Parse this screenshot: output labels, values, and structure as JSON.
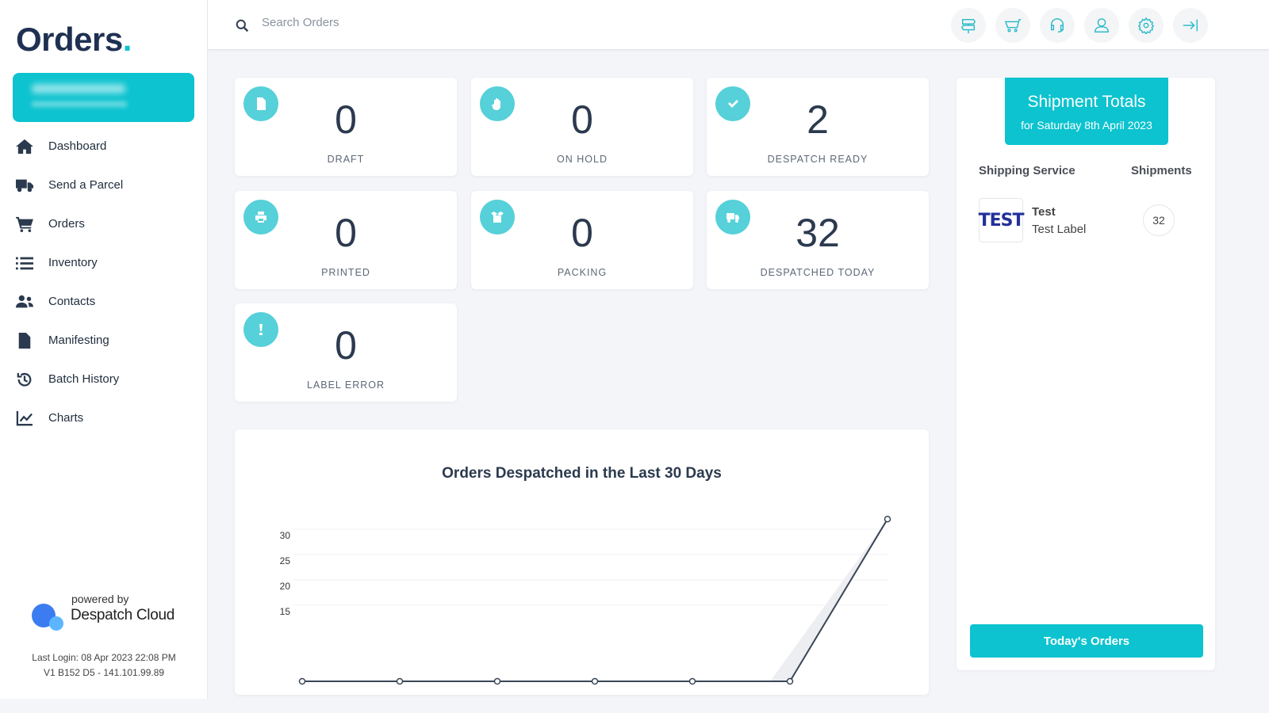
{
  "sidebar": {
    "logo": "Orders",
    "logo_dot": ".",
    "nav": [
      {
        "label": "Dashboard",
        "icon": "home-icon"
      },
      {
        "label": "Send a Parcel",
        "icon": "truck-icon"
      },
      {
        "label": "Orders",
        "icon": "cart-icon"
      },
      {
        "label": "Inventory",
        "icon": "list-icon"
      },
      {
        "label": "Contacts",
        "icon": "users-icon"
      },
      {
        "label": "Manifesting",
        "icon": "document-icon"
      },
      {
        "label": "Batch History",
        "icon": "history-icon"
      },
      {
        "label": "Charts",
        "icon": "line-chart-icon"
      }
    ],
    "powered_by": "powered by",
    "brand": "Despatch Cloud",
    "last_login": "Last Login: 08 Apr 2023 22:08 PM",
    "version": "V1 B152 D5 - 141.101.99.89"
  },
  "topbar": {
    "search_placeholder": "Search Orders",
    "icons": [
      "signpost-icon",
      "cart-icon",
      "headset-icon",
      "user-icon",
      "gear-icon",
      "logout-icon"
    ]
  },
  "stats": [
    {
      "value": "0",
      "label": "DRAFT",
      "icon": "file-edit-icon"
    },
    {
      "value": "0",
      "label": "ON HOLD",
      "icon": "hand-icon"
    },
    {
      "value": "2",
      "label": "DESPATCH READY",
      "icon": "check-icon"
    },
    {
      "value": "0",
      "label": "PRINTED",
      "icon": "printer-icon"
    },
    {
      "value": "0",
      "label": "PACKING",
      "icon": "box-open-icon"
    },
    {
      "value": "32",
      "label": "DESPATCHED TODAY",
      "icon": "truck-icon"
    },
    {
      "value": "0",
      "label": "LABEL ERROR",
      "icon": "exclamation-icon"
    }
  ],
  "chart_data": {
    "type": "line",
    "title": "Orders Despatched in the Last 30 Days",
    "values": [
      0,
      0,
      0,
      0,
      0,
      0,
      32
    ],
    "yticks": [
      "15",
      "20",
      "25",
      "30"
    ],
    "ylim": [
      0,
      33
    ],
    "grid": true,
    "line_color": "#3a4656"
  },
  "shipments": {
    "title": "Shipment Totals",
    "subtitle": "for Saturday 8th April 2023",
    "col_service": "Shipping Service",
    "col_shipments": "Shipments",
    "rows": [
      {
        "logo": "TEST",
        "name": "Test",
        "label": "Test Label",
        "count": "32"
      }
    ],
    "button": "Today's Orders"
  },
  "colors": {
    "accent": "#0cc3cf",
    "icon_bg": "#56d0d9",
    "text": "#2b3a4e"
  }
}
